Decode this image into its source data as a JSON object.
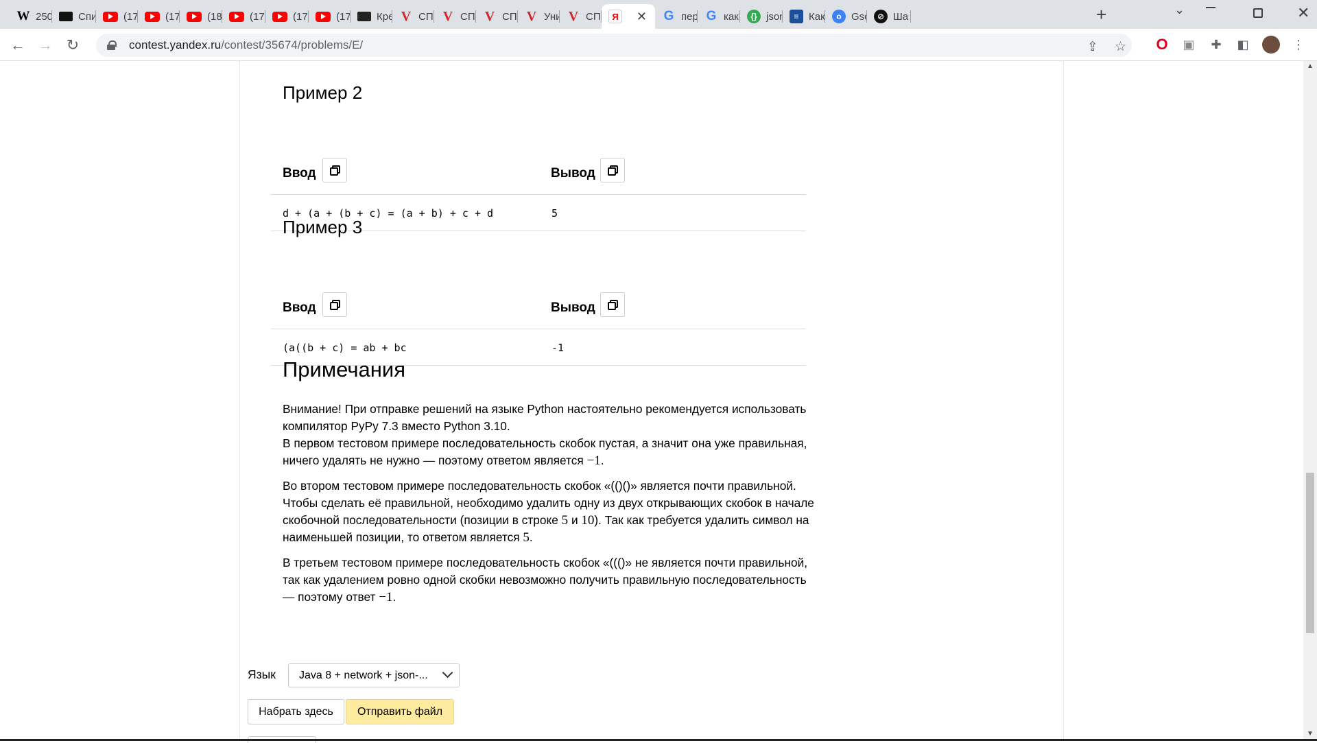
{
  "browser": {
    "tabs": [
      {
        "icon": "wikipedia-icon",
        "glyph": "W",
        "cls": "w",
        "title": "250"
      },
      {
        "icon": "film-icon",
        "glyph": "",
        "cls": "cam",
        "title": "Спи"
      },
      {
        "icon": "youtube-icon",
        "glyph": "",
        "cls": "yt",
        "title": "(17"
      },
      {
        "icon": "youtube-icon",
        "glyph": "",
        "cls": "yt",
        "title": "(17"
      },
      {
        "icon": "youtube-icon",
        "glyph": "",
        "cls": "yt",
        "title": "(18"
      },
      {
        "icon": "youtube-icon",
        "glyph": "",
        "cls": "yt",
        "title": "(17"
      },
      {
        "icon": "youtube-icon",
        "glyph": "",
        "cls": "yt",
        "title": "(17"
      },
      {
        "icon": "youtube-icon",
        "glyph": "",
        "cls": "yt",
        "title": "(17"
      },
      {
        "icon": "film-icon",
        "glyph": "",
        "cls": "film",
        "title": "Кре"
      },
      {
        "icon": "v-icon",
        "glyph": "V",
        "cls": "v",
        "title": "СПб"
      },
      {
        "icon": "v-icon",
        "glyph": "V",
        "cls": "v",
        "title": "СПб"
      },
      {
        "icon": "v-icon",
        "glyph": "V",
        "cls": "v",
        "title": "СПб"
      },
      {
        "icon": "v-icon",
        "glyph": "V",
        "cls": "v",
        "title": "Уни"
      },
      {
        "icon": "v-icon",
        "glyph": "V",
        "cls": "v",
        "title": "СПб"
      },
      {
        "icon": "yandex-icon",
        "glyph": "Я",
        "cls": "ya",
        "title": "",
        "active": true
      },
      {
        "icon": "google-icon",
        "glyph": "G",
        "cls": "g",
        "title": "пер"
      },
      {
        "icon": "google-icon",
        "glyph": "G",
        "cls": "g",
        "title": "как"
      },
      {
        "icon": "json-icon",
        "glyph": "{}",
        "cls": "json",
        "title": "json"
      },
      {
        "icon": "article-icon",
        "glyph": "≡",
        "cls": "blue",
        "title": "Как"
      },
      {
        "icon": "gsc-icon",
        "glyph": "o",
        "cls": "gs",
        "title": "Gsc"
      },
      {
        "icon": "stack-icon",
        "glyph": "⊘",
        "cls": "sh",
        "title": "Ша"
      }
    ],
    "url_host": "contest.yandex.ru",
    "url_path": "/contest/35674/problems/E/"
  },
  "examples": [
    {
      "title": "Пример 2",
      "input_label": "Ввод",
      "output_label": "Вывод",
      "input": "d + (a + (b + c) = (a + b) + c + d",
      "output": "5"
    },
    {
      "title": "Пример 3",
      "input_label": "Ввод",
      "output_label": "Вывод",
      "input": "(a((b + c) = ab + bc",
      "output": "-1"
    }
  ],
  "notes": {
    "title": "Примечания",
    "p1_line1": "Внимание! При отправке решений на языке Python настоятельно рекомендуется использовать компилятор PyPy 7.3 вместо Python 3.10.",
    "p1_line2_text": "В первом тестовом примере последовательность скобок пустая, а значит она уже правильная, ничего удалять не нужно — поэтому ответом является ",
    "p1_line2_math": "−1",
    "p2_text": "Во втором тестовом примере последовательность скобок «(()()» является почти правильной. Чтобы сделать её правильной, необходимо удалить одну из двух открывающих скобок в начале скобочной последовательности (позиции в строке ",
    "p2_math1": "5",
    "p2_and": " и ",
    "p2_math2": "10",
    "p2_text2": "). Так как требуется удалить символ на наименьшей позиции, то ответом является ",
    "p2_math3": "5",
    "p3_text": "В третьем тестовом примере последовательность скобок «((()» не является почти правильной, так как удалением ровно одной скобки невозможно получить правильную последовательность — поэтому ответ ",
    "p3_math": "−1"
  },
  "submit": {
    "language_label": "Язык",
    "language_value": "Java 8 + network + json-...",
    "type_here_label": "Набрать здесь",
    "send_file_label": "Отправить файл"
  }
}
